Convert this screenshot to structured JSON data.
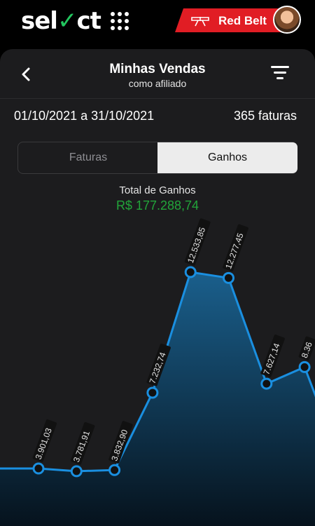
{
  "header": {
    "logo_text_start": "sel",
    "logo_text_check": "✓",
    "logo_text_end": "ct",
    "apps_icon": "grid-icon",
    "badge": {
      "label": "Red Belt",
      "color": "#e11d24",
      "icon": "belt-icon"
    }
  },
  "page": {
    "title": "Minhas Vendas",
    "subtitle": "como afiliado",
    "back_icon": "chevron-left-icon",
    "filter_icon": "filter-icon",
    "date_range": "01/10/2021 a 31/10/2021",
    "invoice_count": "365 faturas"
  },
  "tabs": [
    {
      "label": "Faturas",
      "selected": false
    },
    {
      "label": "Ganhos",
      "selected": true
    }
  ],
  "summary": {
    "label": "Total de Ganhos",
    "value": "R$  177.288,74",
    "value_color": "#22a53a"
  },
  "chart_data": {
    "type": "area",
    "line_color": "#1a8fe0",
    "points": [
      {
        "value": 3901.03,
        "label": "3.901,03"
      },
      {
        "value": 3781.91,
        "label": "3.781,91"
      },
      {
        "value": 3832.9,
        "label": "3.832,90"
      },
      {
        "value": 7232.74,
        "label": "7.232,74"
      },
      {
        "value": 12533.85,
        "label": "12.533,85"
      },
      {
        "value": 12277.45,
        "label": "12.277,45"
      },
      {
        "value": 7627.14,
        "label": "7.627,14"
      },
      {
        "value": 8360,
        "label": "8.36"
      }
    ]
  }
}
